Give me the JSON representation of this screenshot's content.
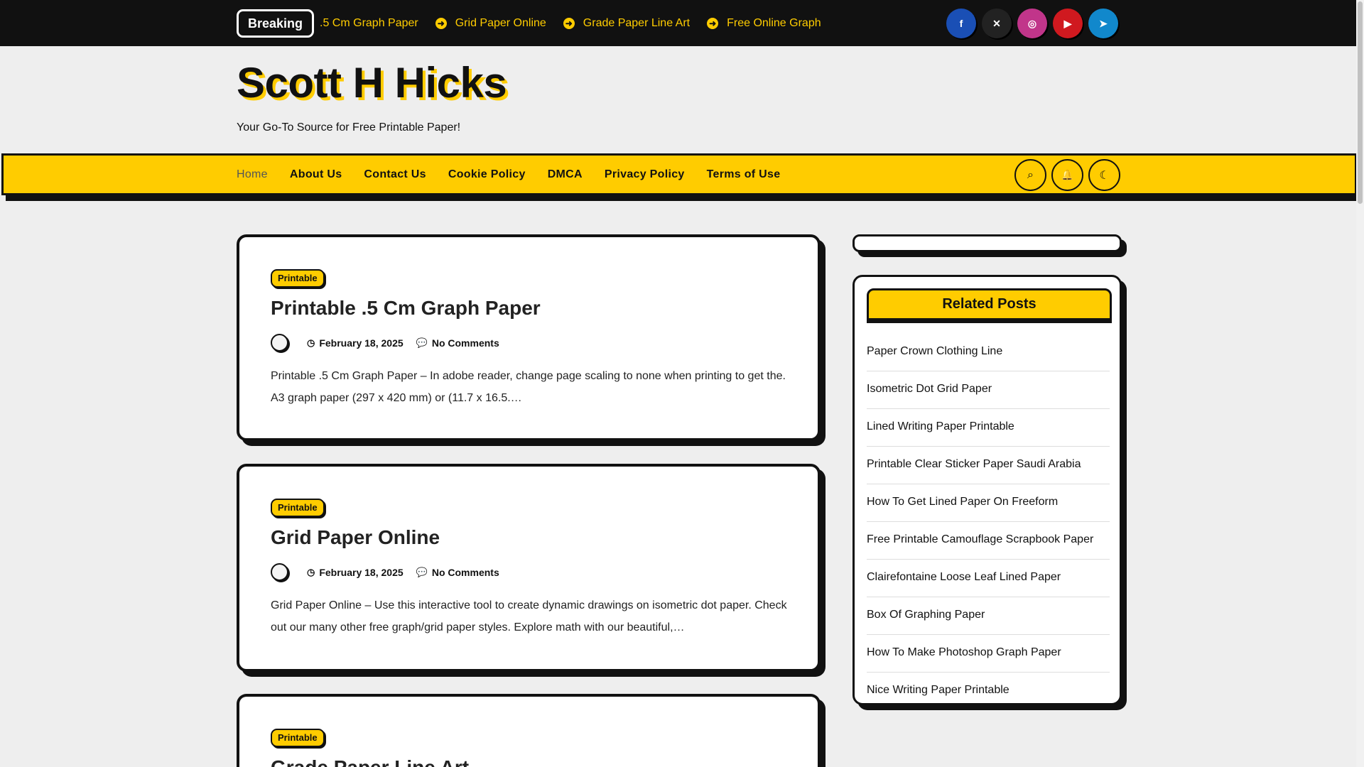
{
  "topbar": {
    "breaking_label": "Breaking",
    "ticker": [
      ".5 Cm Graph Paper",
      "Grid Paper Online",
      "Grade Paper Line Art",
      "Free Online Graph"
    ],
    "socials": [
      {
        "icon": "facebook-icon",
        "glyph": "f",
        "color": "#1a4fb5"
      },
      {
        "icon": "x-icon",
        "glyph": "✕",
        "color": "#222222"
      },
      {
        "icon": "instagram-icon",
        "glyph": "◎",
        "color": "#c1358a"
      },
      {
        "icon": "youtube-icon",
        "glyph": "▶",
        "color": "#d0191f"
      },
      {
        "icon": "telegram-icon",
        "glyph": "➤",
        "color": "#1188cc"
      }
    ]
  },
  "header": {
    "title": "Scott H Hicks",
    "tagline": "Your Go-To Source for Free Printable Paper!"
  },
  "nav": {
    "items": [
      "Home",
      "About Us",
      "Contact Us",
      "Cookie Policy",
      "DMCA",
      "Privacy Policy",
      "Terms of Use"
    ],
    "tools": [
      {
        "icon": "search-icon",
        "glyph": "⌕"
      },
      {
        "icon": "bell-icon",
        "glyph": "🔔"
      },
      {
        "icon": "moon-icon",
        "glyph": "☾"
      }
    ]
  },
  "posts": [
    {
      "category": "Printable",
      "title": "Printable .5 Cm Graph Paper",
      "date": "February 18, 2025",
      "comments": "No Comments",
      "excerpt": "Printable .5 Cm Graph Paper – In adobe reader, change page scaling to none when printing to get the. A3 graph paper (297 x 420 mm) or (11.7 x 16.5.…"
    },
    {
      "category": "Printable",
      "title": "Grid Paper Online",
      "date": "February 18, 2025",
      "comments": "No Comments",
      "excerpt": "Grid Paper Online – Use this interactive tool to create dynamic drawings on isometric dot paper. Check out our many other free graph/grid paper styles. Explore math with our beautiful,…"
    },
    {
      "category": "Printable",
      "title": "Grade Paper Line Art"
    }
  ],
  "sidebar": {
    "related_title": "Related Posts",
    "related": [
      "Paper Crown Clothing Line",
      "Isometric Dot Grid Paper",
      "Lined Writing Paper Printable",
      "Printable Clear Sticker Paper Saudi Arabia",
      "How To Get Lined Paper On Freeform",
      "Free Printable Camouflage Scrapbook Paper",
      "Clairefontaine Loose Leaf Lined Paper",
      "Box Of Graphing Paper",
      "How To Make Photoshop Graph Paper",
      "Nice Writing Paper Printable"
    ]
  },
  "colors": {
    "accent": "#ffcc00",
    "dark": "#111111"
  }
}
